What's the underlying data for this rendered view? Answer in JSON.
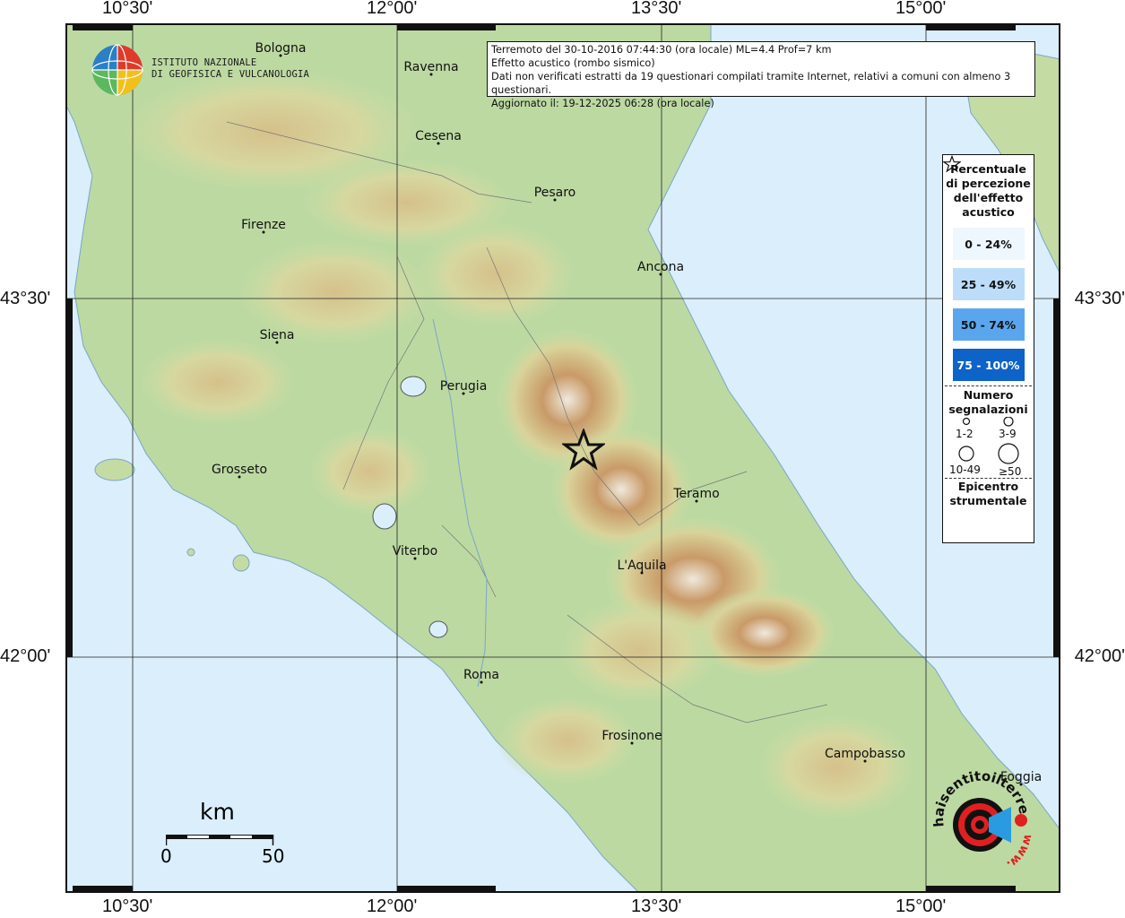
{
  "coords": {
    "top": [
      "10°30'",
      "12°00'",
      "13°30'",
      "15°00'"
    ],
    "bottom": [
      "10°30'",
      "12°00'",
      "13°30'",
      "15°00'"
    ],
    "left": [
      "43°30'",
      "42°00'"
    ],
    "right": [
      "43°30'",
      "42°00'"
    ]
  },
  "institute": {
    "line1": "ISTITUTO NAZIONALE",
    "line2": "DI GEOFISICA E VULCANOLOGIA"
  },
  "info": {
    "line1": "Terremoto del 30-10-2016 07:44:30 (ora locale) ML=4.4 Prof=7 km",
    "line2": "Effetto acustico (rombo sismico)",
    "line3": "Dati non verificati estratti da 19 questionari compilati tramite Internet, relativi a comuni con almeno 3 questionari.",
    "line4": "Aggiornato il: 19-12-2025 06:28 (ora locale)"
  },
  "cities": {
    "bologna": "Bologna",
    "ravenna": "Ravenna",
    "cesena": "Cesena",
    "pesaro": "Pesaro",
    "firenze": "Firenze",
    "ancona": "Ancona",
    "siena": "Siena",
    "perugia": "Perugia",
    "grosseto": "Grosseto",
    "teramo": "Teramo",
    "viterbo": "Viterbo",
    "laquila": "L'Aquila",
    "roma": "Roma",
    "frosinone": "Frosinone",
    "campobasso": "Campobasso",
    "foggia": "Foggia"
  },
  "legend": {
    "title_line1": "Percentuale",
    "title_line2": "di percezione",
    "title_line3": "dell'effetto",
    "title_line4": "acustico",
    "bins": [
      {
        "label": "0 - 24%",
        "color": "#eef6fe"
      },
      {
        "label": "25 - 49%",
        "color": "#bcdcfa"
      },
      {
        "label": "50 - 74%",
        "color": "#5aa6ee"
      },
      {
        "label": "75 - 100%",
        "color": "#0d63c8"
      }
    ],
    "count_title_line1": "Numero",
    "count_title_line2": "segnalazioni",
    "counts": [
      "1-2",
      "3-9",
      "10-49",
      "≥50"
    ],
    "epi_line1": "Epicentro",
    "epi_line2": "strumentale"
  },
  "scale": {
    "unit": "km",
    "start": "0",
    "end": "50"
  },
  "logo": {
    "text": "haisentitoilterremoto.it",
    "text_bottom": "www."
  },
  "colors": {
    "sea": "#dbeefb",
    "lowland": "#b7d6a0",
    "hills": "#d8d8a0",
    "mountains": "#c8a070",
    "peaks": "#f2f0ec"
  }
}
